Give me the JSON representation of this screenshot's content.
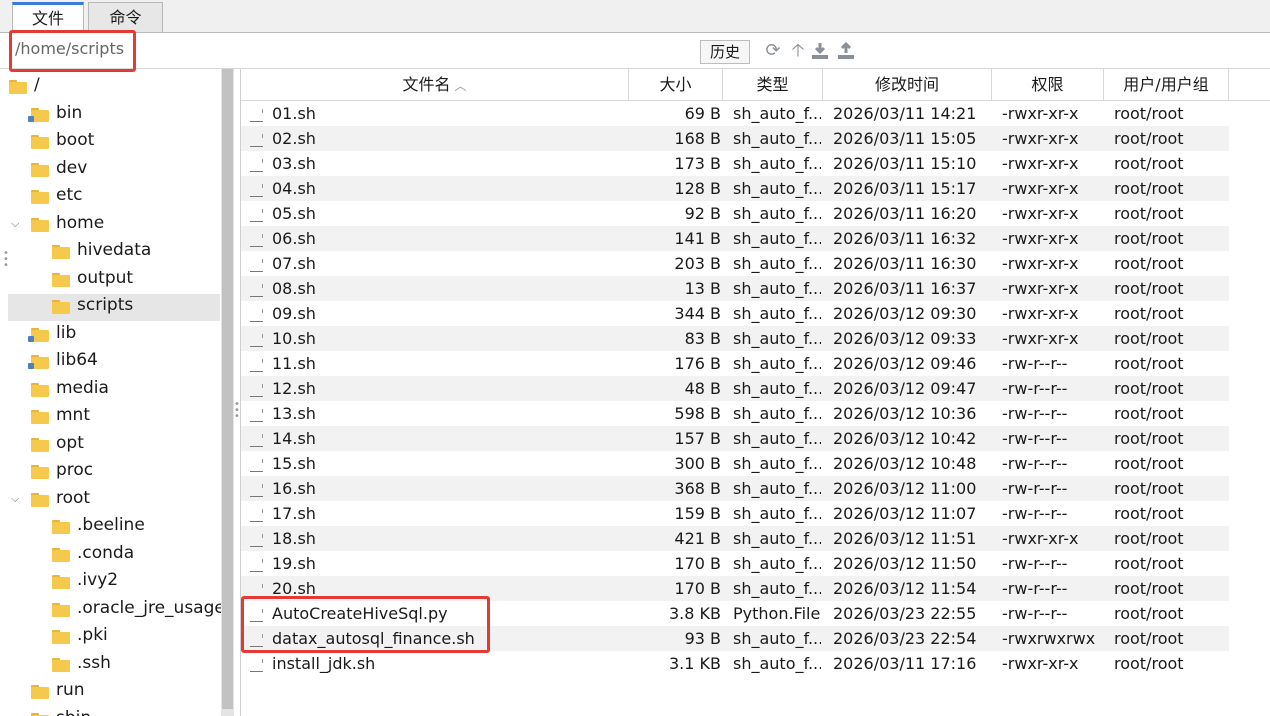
{
  "tabs": [
    {
      "label": "文件"
    },
    {
      "label": "命令"
    }
  ],
  "path": {
    "value": "/home/scripts"
  },
  "toolbar": {
    "history_label": "历史",
    "icons": [
      "refresh-icon",
      "up-arrow-icon",
      "download-icon",
      "upload-icon"
    ]
  },
  "tree": [
    {
      "label": "/",
      "indent": 0,
      "expand": "open",
      "link": false
    },
    {
      "label": "bin",
      "indent": 1,
      "expand": "none",
      "link": true
    },
    {
      "label": "boot",
      "indent": 1,
      "expand": "none",
      "link": false
    },
    {
      "label": "dev",
      "indent": 1,
      "expand": "none",
      "link": false
    },
    {
      "label": "etc",
      "indent": 1,
      "expand": "none",
      "link": false
    },
    {
      "label": "home",
      "indent": 1,
      "expand": "open",
      "link": false
    },
    {
      "label": "hivedata",
      "indent": 2,
      "expand": "none",
      "link": false
    },
    {
      "label": "output",
      "indent": 2,
      "expand": "none",
      "link": false
    },
    {
      "label": "scripts",
      "indent": 2,
      "expand": "none",
      "link": false,
      "selected": true
    },
    {
      "label": "lib",
      "indent": 1,
      "expand": "none",
      "link": true
    },
    {
      "label": "lib64",
      "indent": 1,
      "expand": "none",
      "link": true
    },
    {
      "label": "media",
      "indent": 1,
      "expand": "none",
      "link": false
    },
    {
      "label": "mnt",
      "indent": 1,
      "expand": "none",
      "link": false
    },
    {
      "label": "opt",
      "indent": 1,
      "expand": "none",
      "link": false
    },
    {
      "label": "proc",
      "indent": 1,
      "expand": "none",
      "link": false
    },
    {
      "label": "root",
      "indent": 1,
      "expand": "open",
      "link": false
    },
    {
      "label": ".beeline",
      "indent": 2,
      "expand": "none",
      "link": false
    },
    {
      "label": ".conda",
      "indent": 2,
      "expand": "none",
      "link": false
    },
    {
      "label": ".ivy2",
      "indent": 2,
      "expand": "none",
      "link": false
    },
    {
      "label": ".oracle_jre_usage",
      "indent": 2,
      "expand": "none",
      "link": false
    },
    {
      "label": ".pki",
      "indent": 2,
      "expand": "none",
      "link": false
    },
    {
      "label": ".ssh",
      "indent": 2,
      "expand": "none",
      "link": false
    },
    {
      "label": "run",
      "indent": 1,
      "expand": "none",
      "link": false
    },
    {
      "label": "sbin",
      "indent": 1,
      "expand": "none",
      "link": true
    }
  ],
  "columns": [
    "文件名",
    "大小",
    "类型",
    "修改时间",
    "权限",
    "用户/用户组"
  ],
  "files": [
    {
      "name": "01.sh",
      "size": "69 B",
      "type": "sh_auto_f...",
      "mtime": "2026/03/11 14:21",
      "perm": "-rwxr-xr-x",
      "owner": "root/root"
    },
    {
      "name": "02.sh",
      "size": "168 B",
      "type": "sh_auto_f...",
      "mtime": "2026/03/11 15:05",
      "perm": "-rwxr-xr-x",
      "owner": "root/root"
    },
    {
      "name": "03.sh",
      "size": "173 B",
      "type": "sh_auto_f...",
      "mtime": "2026/03/11 15:10",
      "perm": "-rwxr-xr-x",
      "owner": "root/root"
    },
    {
      "name": "04.sh",
      "size": "128 B",
      "type": "sh_auto_f...",
      "mtime": "2026/03/11 15:17",
      "perm": "-rwxr-xr-x",
      "owner": "root/root"
    },
    {
      "name": "05.sh",
      "size": "92 B",
      "type": "sh_auto_f...",
      "mtime": "2026/03/11 16:20",
      "perm": "-rwxr-xr-x",
      "owner": "root/root"
    },
    {
      "name": "06.sh",
      "size": "141 B",
      "type": "sh_auto_f...",
      "mtime": "2026/03/11 16:32",
      "perm": "-rwxr-xr-x",
      "owner": "root/root"
    },
    {
      "name": "07.sh",
      "size": "203 B",
      "type": "sh_auto_f...",
      "mtime": "2026/03/11 16:30",
      "perm": "-rwxr-xr-x",
      "owner": "root/root"
    },
    {
      "name": "08.sh",
      "size": "13 B",
      "type": "sh_auto_f...",
      "mtime": "2026/03/11 16:37",
      "perm": "-rwxr-xr-x",
      "owner": "root/root"
    },
    {
      "name": "09.sh",
      "size": "344 B",
      "type": "sh_auto_f...",
      "mtime": "2026/03/12 09:30",
      "perm": "-rwxr-xr-x",
      "owner": "root/root"
    },
    {
      "name": "10.sh",
      "size": "83 B",
      "type": "sh_auto_f...",
      "mtime": "2026/03/12 09:33",
      "perm": "-rwxr-xr-x",
      "owner": "root/root"
    },
    {
      "name": "11.sh",
      "size": "176 B",
      "type": "sh_auto_f...",
      "mtime": "2026/03/12 09:46",
      "perm": "-rw-r--r--",
      "owner": "root/root"
    },
    {
      "name": "12.sh",
      "size": "48 B",
      "type": "sh_auto_f...",
      "mtime": "2026/03/12 09:47",
      "perm": "-rw-r--r--",
      "owner": "root/root"
    },
    {
      "name": "13.sh",
      "size": "598 B",
      "type": "sh_auto_f...",
      "mtime": "2026/03/12 10:36",
      "perm": "-rw-r--r--",
      "owner": "root/root"
    },
    {
      "name": "14.sh",
      "size": "157 B",
      "type": "sh_auto_f...",
      "mtime": "2026/03/12 10:42",
      "perm": "-rw-r--r--",
      "owner": "root/root"
    },
    {
      "name": "15.sh",
      "size": "300 B",
      "type": "sh_auto_f...",
      "mtime": "2026/03/12 10:48",
      "perm": "-rw-r--r--",
      "owner": "root/root"
    },
    {
      "name": "16.sh",
      "size": "368 B",
      "type": "sh_auto_f...",
      "mtime": "2026/03/12 11:00",
      "perm": "-rw-r--r--",
      "owner": "root/root"
    },
    {
      "name": "17.sh",
      "size": "159 B",
      "type": "sh_auto_f...",
      "mtime": "2026/03/12 11:07",
      "perm": "-rw-r--r--",
      "owner": "root/root"
    },
    {
      "name": "18.sh",
      "size": "421 B",
      "type": "sh_auto_f...",
      "mtime": "2026/03/12 11:51",
      "perm": "-rwxr-xr-x",
      "owner": "root/root"
    },
    {
      "name": "19.sh",
      "size": "170 B",
      "type": "sh_auto_f...",
      "mtime": "2026/03/12 11:50",
      "perm": "-rw-r--r--",
      "owner": "root/root"
    },
    {
      "name": "20.sh",
      "size": "170 B",
      "type": "sh_auto_f...",
      "mtime": "2026/03/12 11:54",
      "perm": "-rw-r--r--",
      "owner": "root/root"
    },
    {
      "name": "AutoCreateHiveSql.py",
      "size": "3.8 KB",
      "type": "Python.File",
      "mtime": "2026/03/23 22:55",
      "perm": "-rw-r--r--",
      "owner": "root/root"
    },
    {
      "name": "datax_autosql_finance.sh",
      "size": "93 B",
      "type": "sh_auto_f...",
      "mtime": "2026/03/23 22:54",
      "perm": "-rwxrwxrwx",
      "owner": "root/root"
    },
    {
      "name": "install_jdk.sh",
      "size": "3.1 KB",
      "type": "sh_auto_f...",
      "mtime": "2026/03/11 17:16",
      "perm": "-rwxr-xr-x",
      "owner": "root/root"
    }
  ],
  "colors": {
    "highlight": "#e53935",
    "accent": "#3a7bd5",
    "folder": "#f5c94c"
  }
}
